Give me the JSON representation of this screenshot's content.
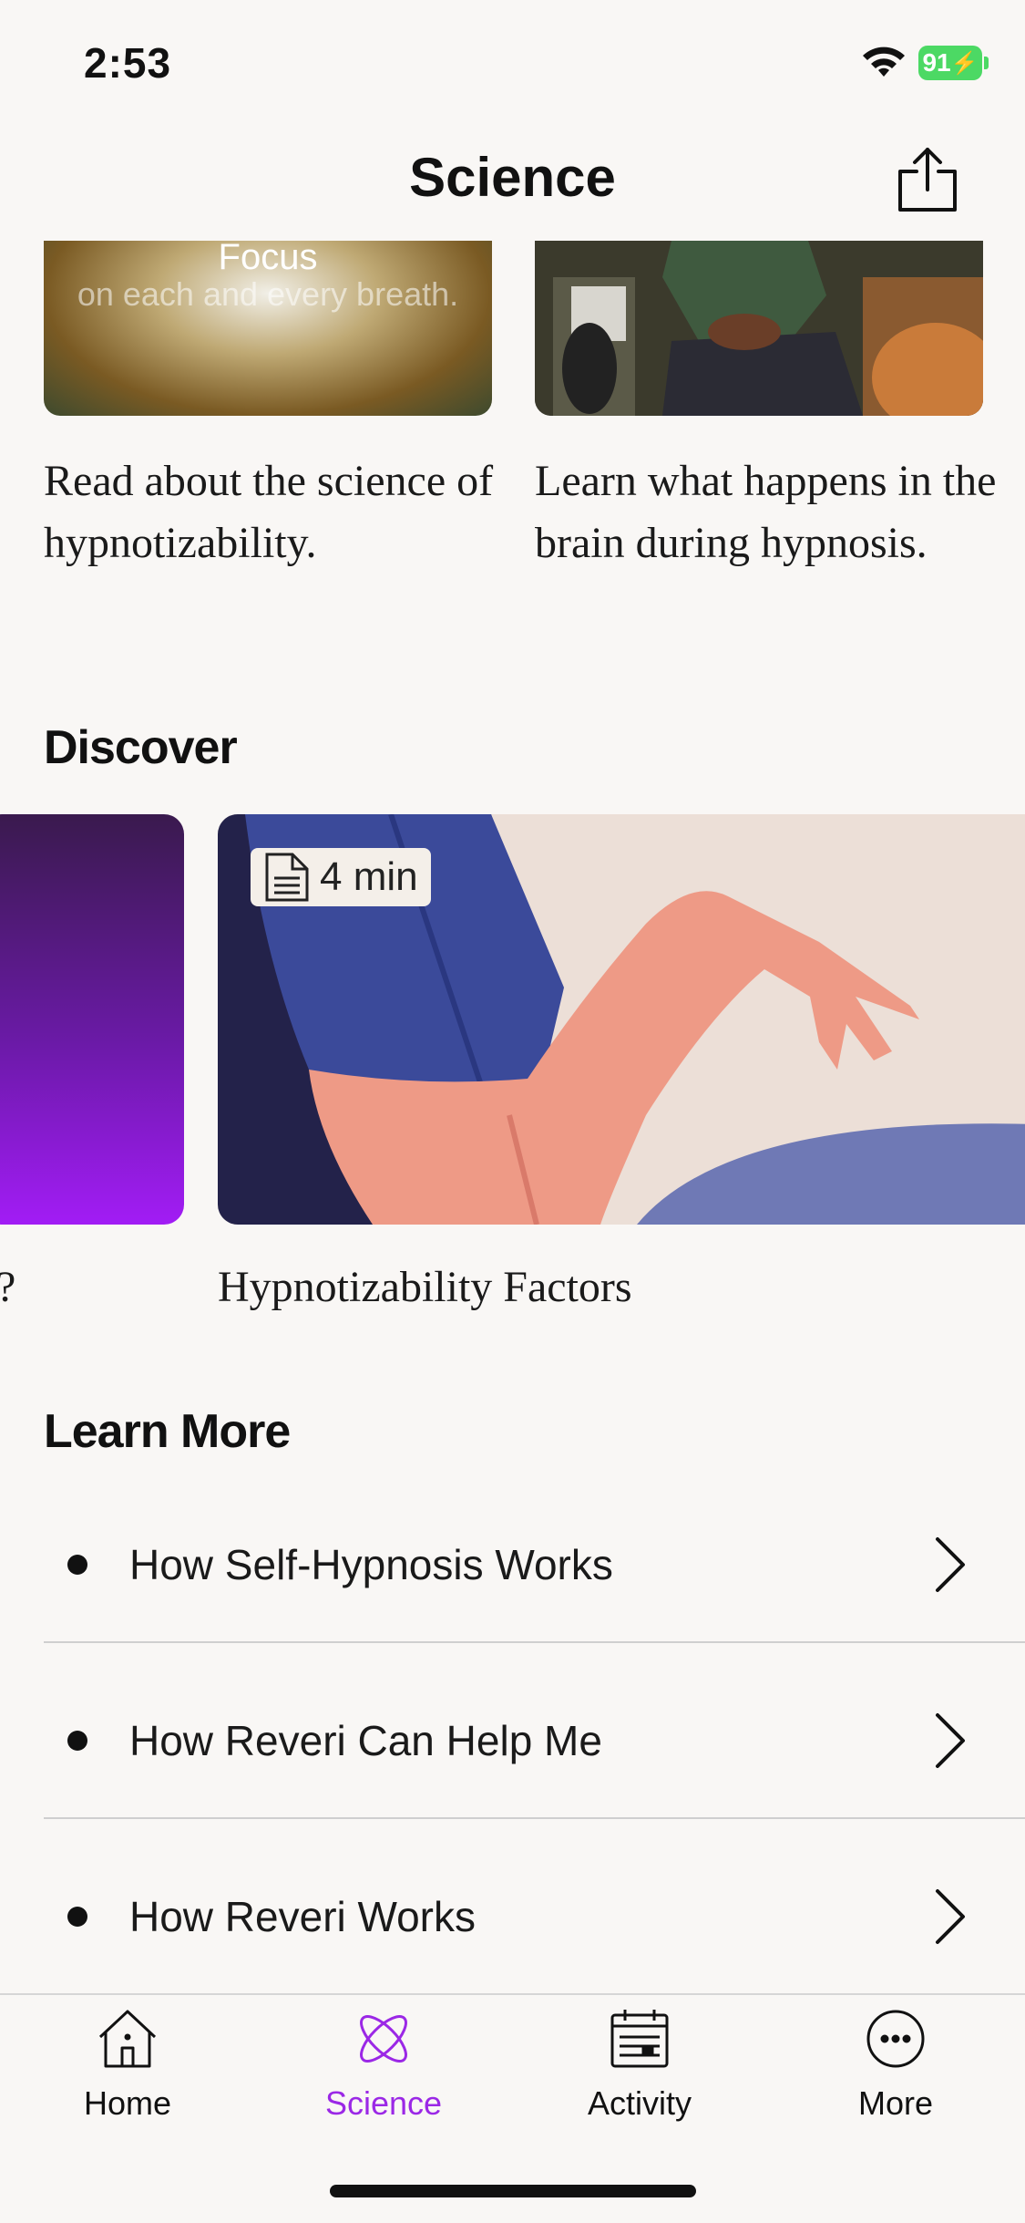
{
  "status_bar": {
    "time": "2:53",
    "battery": "91"
  },
  "header": {
    "title": "Science"
  },
  "top_cards": [
    {
      "image_text_title": "Focus",
      "image_text_sub": "on each and every breath.",
      "text": "Read about the science of hypnotizability."
    },
    {
      "text": "Learn what happens in the brain during hypnosis."
    }
  ],
  "discover": {
    "title": "Discover",
    "items": [
      {
        "caption": "?"
      },
      {
        "caption": "Hypnotizability Factors",
        "duration": "4 min"
      }
    ]
  },
  "learn_more": {
    "title": "Learn More",
    "items": [
      {
        "label": "How Self-Hypnosis Works"
      },
      {
        "label": "How Reveri Can Help Me"
      },
      {
        "label": "How Reveri Works"
      }
    ]
  },
  "tab_bar": {
    "active_color": "#9b28e6",
    "items": [
      {
        "label": "Home",
        "icon": "house-icon"
      },
      {
        "label": "Science",
        "icon": "atom-icon"
      },
      {
        "label": "Activity",
        "icon": "calendar-icon"
      },
      {
        "label": "More",
        "icon": "ellipsis-circle-icon"
      }
    ]
  }
}
